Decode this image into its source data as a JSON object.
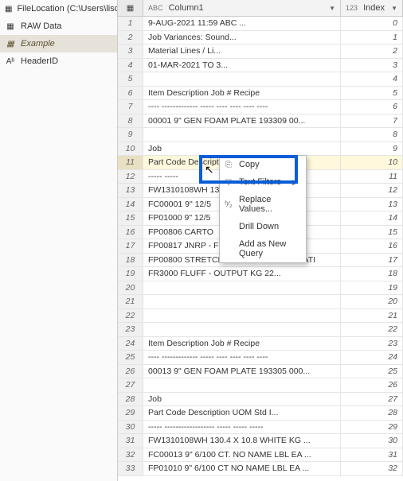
{
  "sidebar": {
    "items": [
      {
        "label": "FileLocation (C:\\Users\\lisde..."
      },
      {
        "label": "RAW Data"
      },
      {
        "label": "Example"
      },
      {
        "label": "HeaderID"
      }
    ]
  },
  "grid": {
    "col1_type": "ABC",
    "col1_label": "Column1",
    "col2_type": "123",
    "col2_label": "Index",
    "rows": [
      {
        "n": "1",
        "c1": "9-AUG-2021 11:59                          ABC ...",
        "c2": "0"
      },
      {
        "n": "2",
        "c1": "                                Job Variances: Sound...",
        "c2": "1"
      },
      {
        "n": "3",
        "c1": "                                Material Lines / Li...",
        "c2": "2"
      },
      {
        "n": "4",
        "c1": "                                01-MAR-2021 TO 3...",
        "c2": "3"
      },
      {
        "n": "5",
        "c1": "",
        "c2": "4"
      },
      {
        "n": "6",
        "c1": "Item       Description        Job #   Recipe",
        "c2": "5"
      },
      {
        "n": "7",
        "c1": "----       -------------      -----   ---- ---- ---- ----",
        "c2": "6"
      },
      {
        "n": "8",
        "c1": "00001    9\" GEN FOAM PLATE        193309 00...",
        "c2": "7"
      },
      {
        "n": "9",
        "c1": "",
        "c2": "8"
      },
      {
        "n": "10",
        "c1": "                                      Job",
        "c2": "9"
      },
      {
        "n": "11",
        "c1": "   Part Code   Description        UOM    Std I...",
        "c2": "10",
        "selected": true
      },
      {
        "n": "12",
        "c1": "   -----          -----",
        "c2": "11"
      },
      {
        "n": "13",
        "c1": "   FW1310108WH  13",
        "c2": "12"
      },
      {
        "n": "14",
        "c1": "   FC00001    9\" 12/5",
        "c2": "13"
      },
      {
        "n": "15",
        "c1": "   FP01000    9\" 12/5",
        "c2": "14"
      },
      {
        "n": "16",
        "c1": "   FP00806    CARTO",
        "c2": "15"
      },
      {
        "n": "17",
        "c1": "   FP00817    JNRP - FILM WHITE                 EA",
        "c2": "16"
      },
      {
        "n": "18",
        "c1": "   FP00800    STRETCH WRAP FOR AUTOMATI",
        "c2": "17"
      },
      {
        "n": "19",
        "c1": "   FR3000      FLUFF - OUTPUT        KG       22...",
        "c2": "18"
      },
      {
        "n": "20",
        "c1": "",
        "c2": "19"
      },
      {
        "n": "21",
        "c1": "",
        "c2": "20"
      },
      {
        "n": "22",
        "c1": "",
        "c2": "21"
      },
      {
        "n": "23",
        "c1": "",
        "c2": "22"
      },
      {
        "n": "24",
        "c1": "Item       Description        Job #   Recipe",
        "c2": "23"
      },
      {
        "n": "25",
        "c1": "----       -------------      -----   ---- ---- ---- ----",
        "c2": "24"
      },
      {
        "n": "26",
        "c1": "00013    9\" GEN FOAM PLATE        193305 000...",
        "c2": "25"
      },
      {
        "n": "27",
        "c1": "",
        "c2": "26"
      },
      {
        "n": "28",
        "c1": "                                      Job",
        "c2": "27"
      },
      {
        "n": "29",
        "c1": "   Part Code   Description        UOM     Std I...",
        "c2": "28"
      },
      {
        "n": "30",
        "c1": "   -----        ------------------    -----    ----- -----",
        "c2": "29"
      },
      {
        "n": "31",
        "c1": "   FW1310108WH  130.4 X 10.8     WHITE KG  ...",
        "c2": "30"
      },
      {
        "n": "32",
        "c1": "   FC00013    9\" 6/100 CT. NO NAME LBL  EA  ...",
        "c2": "31"
      },
      {
        "n": "33",
        "c1": "   FP01010    9\" 6/100 CT NO NAME LBL  EA   ...",
        "c2": "32"
      }
    ]
  },
  "context_menu": {
    "copy": "Copy",
    "filters": "Text Filters",
    "replace": "Replace Values...",
    "drill": "Drill Down",
    "addquery": "Add as New Query"
  }
}
